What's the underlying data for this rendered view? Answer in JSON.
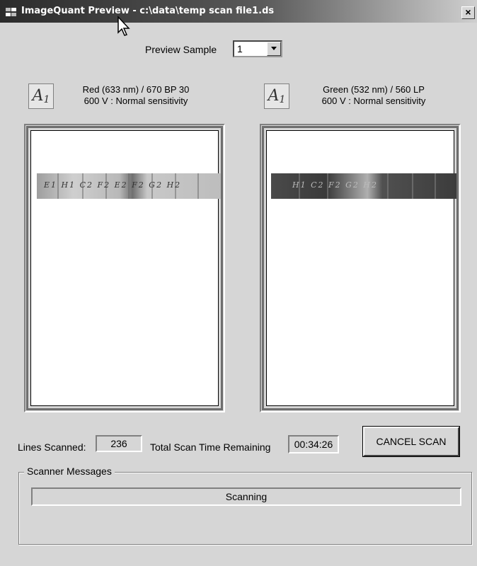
{
  "window": {
    "title": "ImageQuant Preview - c:\\data\\temp scan file1.ds",
    "close_label": "×"
  },
  "preview_sample": {
    "label": "Preview Sample",
    "value": "1"
  },
  "channels": [
    {
      "icon": "A",
      "icon_sub": "1",
      "line1": "Red (633 nm) / 670 BP 30",
      "line2": "600 V : Normal sensitivity",
      "strip_text": "E1 H1 C2 F2 E2 F2 G2 H2"
    },
    {
      "icon": "A",
      "icon_sub": "1",
      "line1": "Green (532 nm) / 560 LP",
      "line2": "600 V : Normal sensitivity",
      "strip_text": "H1 C2 F2 G2 H2"
    }
  ],
  "status": {
    "lines_label": "Lines Scanned:",
    "lines_value": "236",
    "time_label": "Total Scan Time Remaining",
    "time_value": "00:34:26",
    "cancel_label": "CANCEL SCAN"
  },
  "messages": {
    "group_label": "Scanner Messages",
    "text": "Scanning"
  },
  "colors": {
    "titlebar_dark": "#2b2b2b",
    "face": "#d6d6d6"
  }
}
